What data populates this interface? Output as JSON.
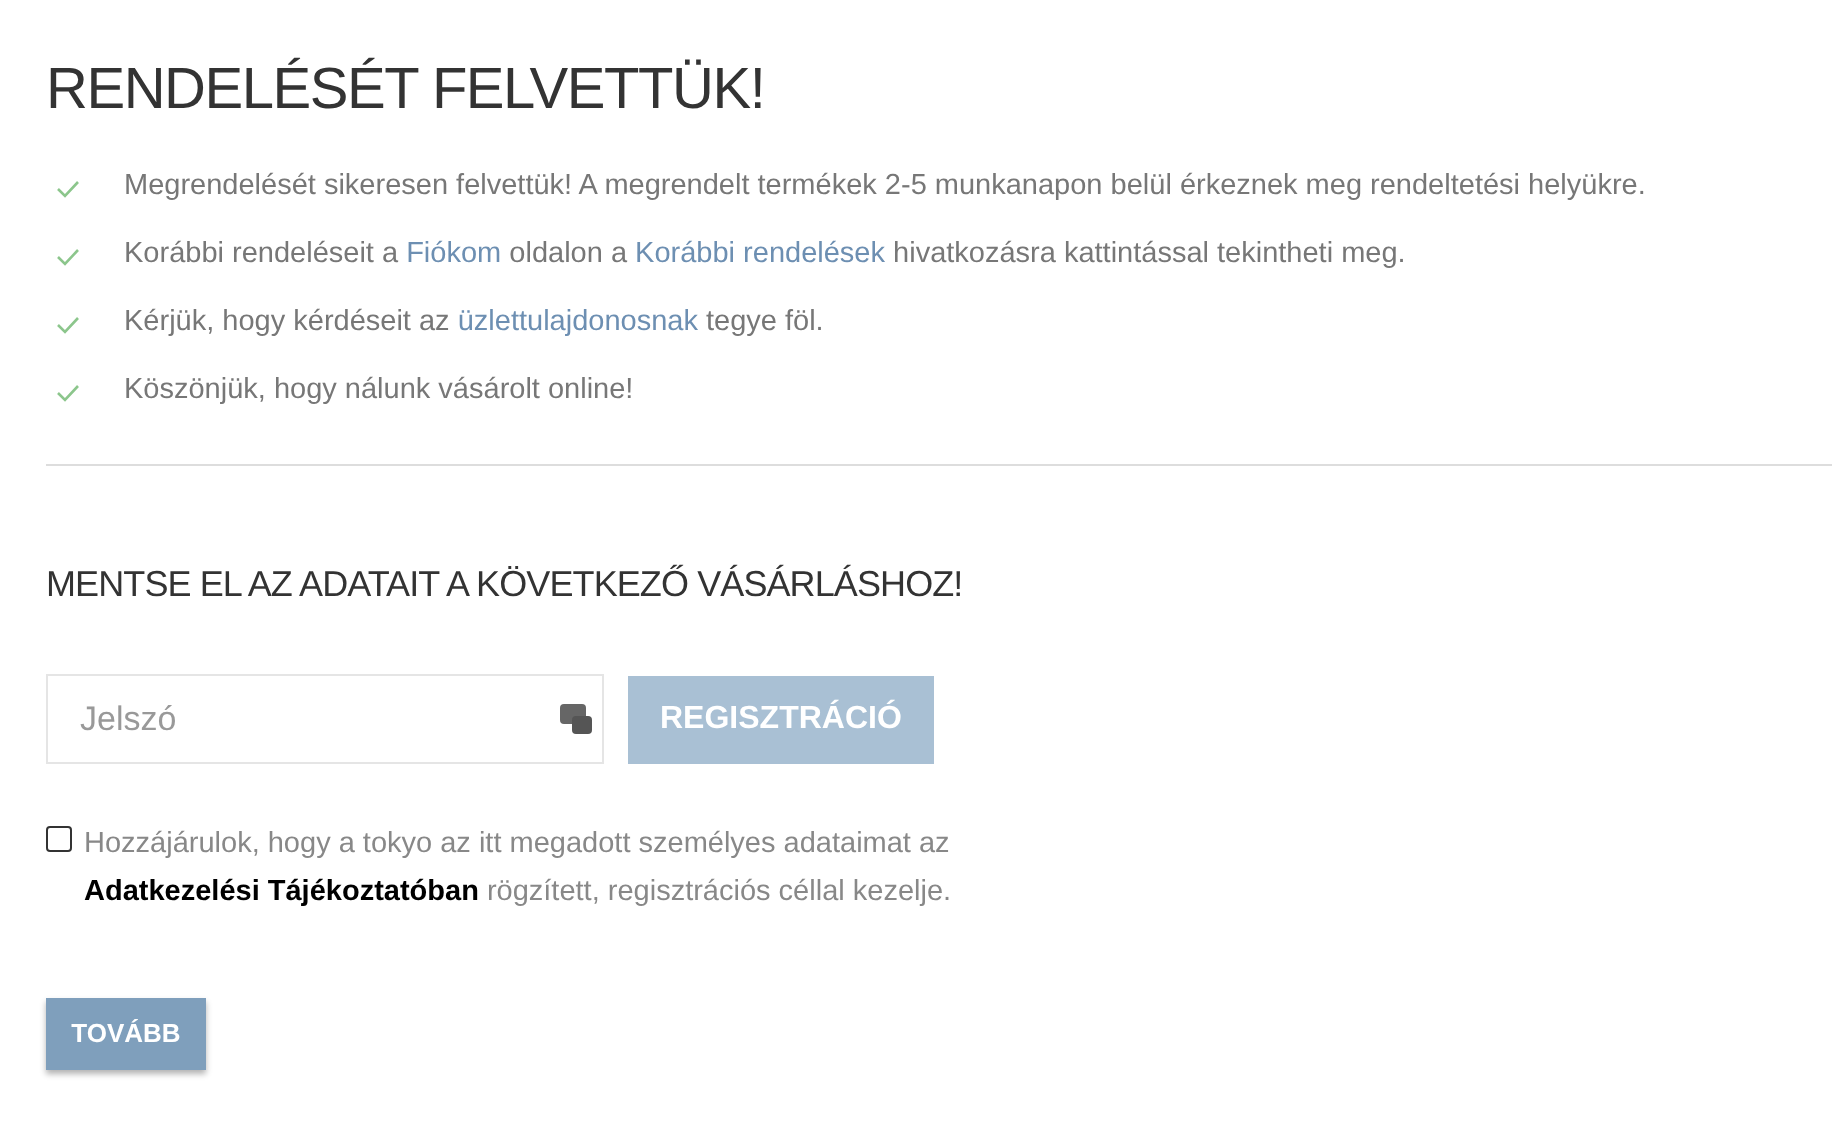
{
  "title": "RENDELÉSÉT FELVETTÜK!",
  "items": [
    {
      "parts": [
        {
          "kind": "text",
          "text": "Megrendelését sikeresen felvettük! A megrendelt termékek 2-5 munkanapon belül érkeznek meg rendeltetési helyükre."
        }
      ]
    },
    {
      "parts": [
        {
          "kind": "text",
          "text": "Korábbi rendeléseit a "
        },
        {
          "kind": "link",
          "text": "Fiókom"
        },
        {
          "kind": "text",
          "text": " oldalon a "
        },
        {
          "kind": "link",
          "text": "Korábbi rendelések"
        },
        {
          "kind": "text",
          "text": " hivatkozásra kattintással tekintheti meg."
        }
      ]
    },
    {
      "parts": [
        {
          "kind": "text",
          "text": "Kérjük, hogy kérdéseit az "
        },
        {
          "kind": "link",
          "text": "üzlettulajdonosnak"
        },
        {
          "kind": "text",
          "text": " tegye föl."
        }
      ]
    },
    {
      "parts": [
        {
          "kind": "text",
          "text": "Köszönjük, hogy nálunk vásárolt online!"
        }
      ]
    }
  ],
  "save_heading": "MENTSE EL AZ ADATAIT A KÖVETKEZŐ VÁSÁRLÁSHOZ!",
  "password": {
    "placeholder": "Jelszó"
  },
  "register_button": {
    "label": "REGISZTRÁCIÓ",
    "disabled": true
  },
  "consent": {
    "checked": false,
    "text": "Hozzájárulok, hogy a tokyo az itt megadott személyes adataimat az **Adatkezelési Tájékoztatóban** rögzített, regisztrációs céllal kezelje."
  },
  "next_button": "TOVÁBB"
}
